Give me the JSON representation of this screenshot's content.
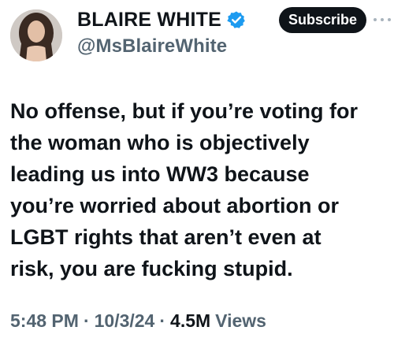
{
  "author": {
    "display_name": "BLAIRE WHITE",
    "handle": "@MsBlaireWhite",
    "verified": true,
    "verified_color": "#1d9bf0"
  },
  "actions": {
    "subscribe_label": "Subscribe",
    "more_icon": "more-horizontal-icon"
  },
  "tweet": {
    "lines": [
      "No offense, but if you’re voting for",
      "the woman who is objectively",
      "leading us into WW3 because",
      "you’re worried about abortion or",
      "LGBT rights that aren’t even at",
      "risk, you are fucking stupid."
    ]
  },
  "meta": {
    "time": "5:48 PM",
    "date": "10/3/24",
    "views_count": "4.5M",
    "views_label": "Views",
    "separator": "·"
  }
}
